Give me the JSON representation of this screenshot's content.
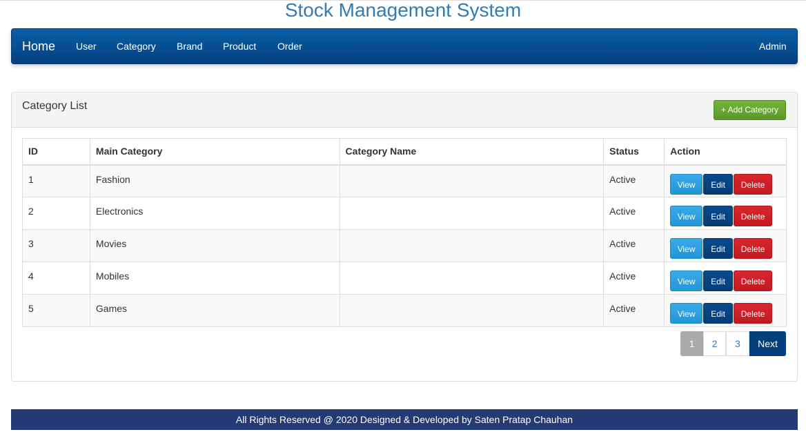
{
  "site_title": "Stock Management System",
  "nav": {
    "home": "Home",
    "user": "User",
    "category": "Category",
    "brand": "Brand",
    "product": "Product",
    "order": "Order",
    "admin": "Admin"
  },
  "panel": {
    "title": "Category List",
    "add_button": "+ Add Category"
  },
  "table": {
    "headers": [
      "ID",
      "Main Category",
      "Category Name",
      "Status",
      "Action"
    ],
    "rows": [
      {
        "id": "1",
        "main_category": "Fashion",
        "category_name": "",
        "status": "Active"
      },
      {
        "id": "2",
        "main_category": "Electronics",
        "category_name": "",
        "status": "Active"
      },
      {
        "id": "3",
        "main_category": "Movies",
        "category_name": "",
        "status": "Active"
      },
      {
        "id": "4",
        "main_category": "Mobiles",
        "category_name": "",
        "status": "Active"
      },
      {
        "id": "5",
        "main_category": "Games",
        "category_name": "",
        "status": "Active"
      }
    ],
    "actions": {
      "view": "View",
      "edit": "Edit",
      "delete": "Delete"
    }
  },
  "pagination": {
    "pages": [
      "1",
      "2",
      "3"
    ],
    "current": "1",
    "next": "Next"
  },
  "footer": "All Rights Reserved @ 2020 Designed & Developed by Saten Pratap Chauhan",
  "colors": {
    "title": "#337ab7",
    "navbar": "#084f93",
    "add_button": "#5b9a2a",
    "status_active": "#3c763d",
    "view_button": "#2196d8",
    "edit_button": "#063c76",
    "delete_button": "#c21a22",
    "footer": "#243a74"
  }
}
